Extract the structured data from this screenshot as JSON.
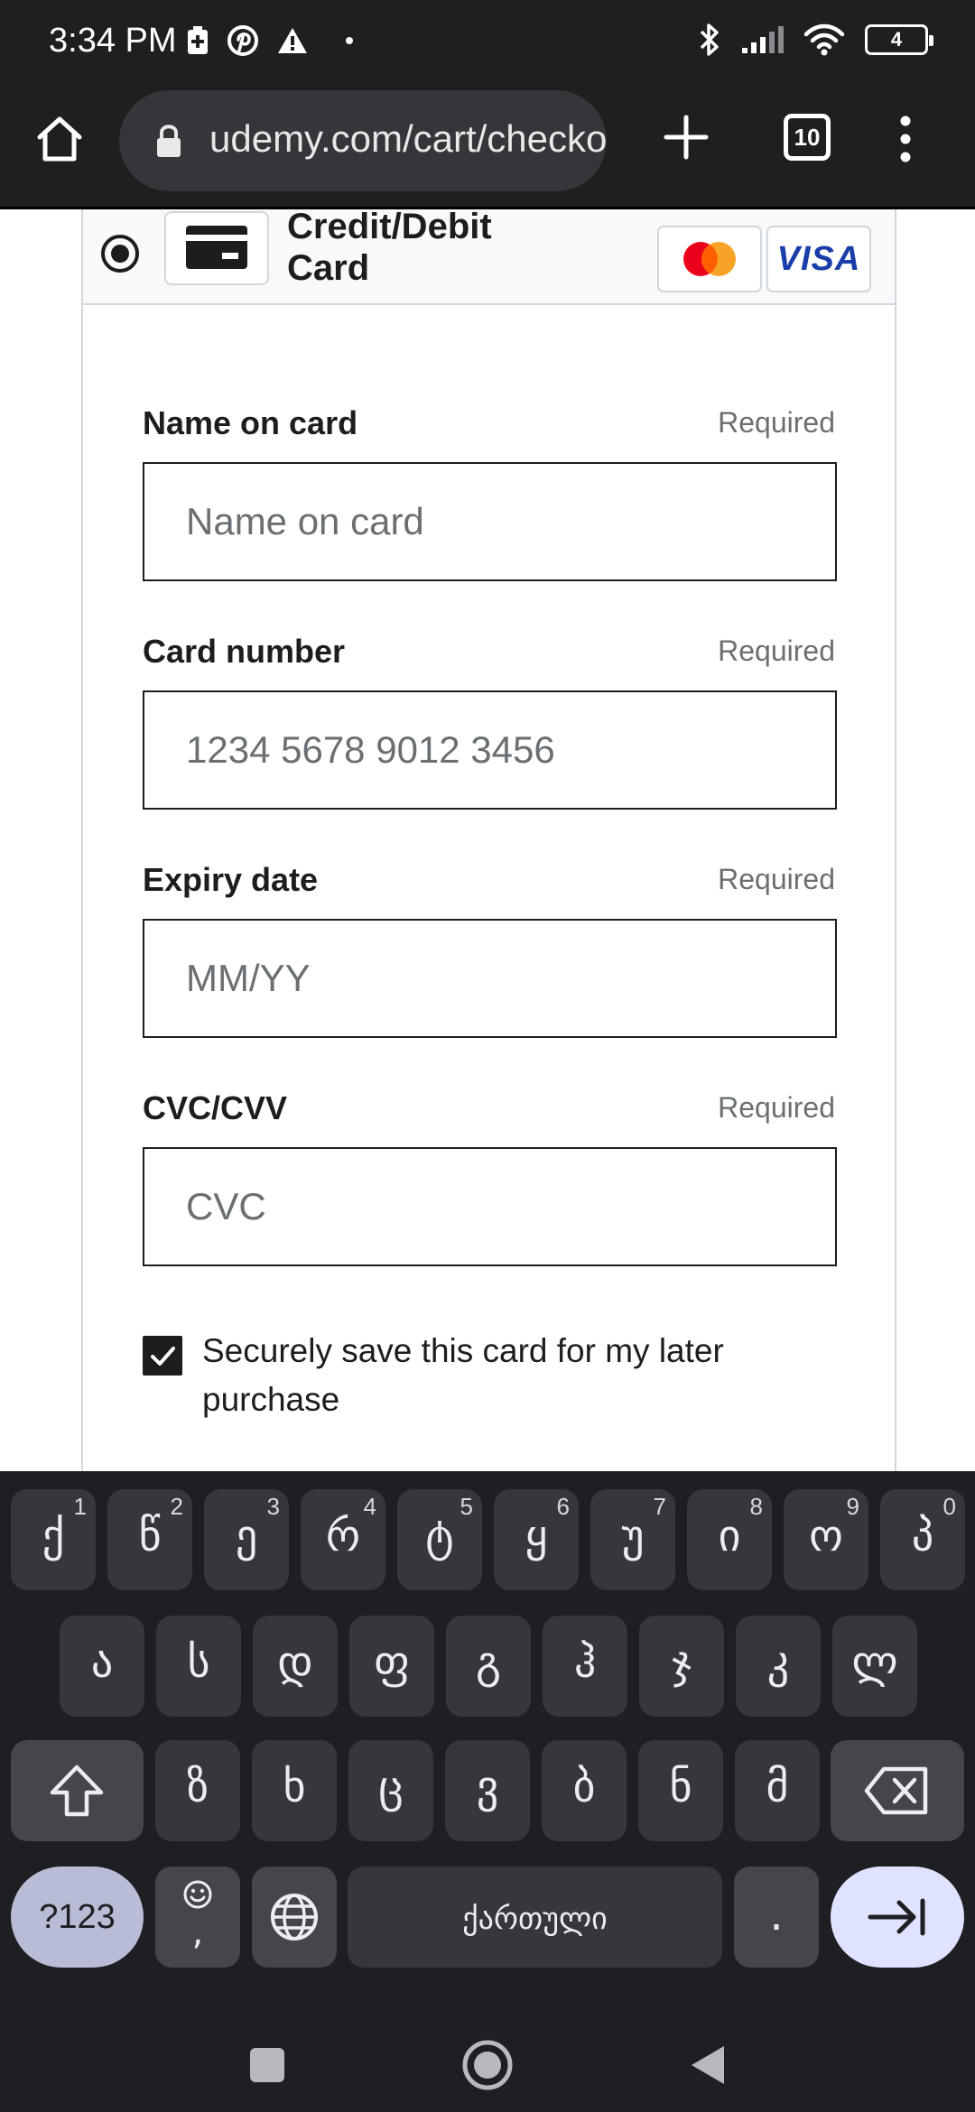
{
  "status_bar": {
    "time": "3:34 PM",
    "battery_level": "4",
    "left_icons": [
      "battery-saver-icon",
      "pinterest-icon",
      "warning-icon",
      "dot-icon"
    ],
    "right_icons": [
      "bluetooth-icon",
      "signal-icon",
      "wifi-icon",
      "battery-icon"
    ]
  },
  "browser": {
    "url": "udemy.com/cart/checkout",
    "tab_count": "10",
    "icons": [
      "home-icon",
      "lock-icon",
      "plus-icon",
      "tabs-icon",
      "more-vert-icon"
    ]
  },
  "payment": {
    "method_label_line1": "Credit/Debit",
    "method_label_line2": "Card",
    "brands": [
      "mastercard-logo",
      "visa-logo"
    ],
    "visa_text": "VISA",
    "fields": {
      "name": {
        "label": "Name on card",
        "required": "Required",
        "placeholder": "Name on card"
      },
      "number": {
        "label": "Card number",
        "required": "Required",
        "placeholder": "1234 5678 9012 3456"
      },
      "expiry": {
        "label": "Expiry date",
        "required": "Required",
        "placeholder": "MM/YY"
      },
      "cvc": {
        "label": "CVC/CVV",
        "required": "Required",
        "placeholder": "CVC"
      }
    },
    "save_card_label": "Securely save this card for my later purchase",
    "save_card_checked": true
  },
  "keyboard": {
    "row1": [
      {
        "char": "ქ",
        "hint": "1"
      },
      {
        "char": "წ",
        "hint": "2"
      },
      {
        "char": "ე",
        "hint": "3"
      },
      {
        "char": "რ",
        "hint": "4"
      },
      {
        "char": "ტ",
        "hint": "5"
      },
      {
        "char": "ყ",
        "hint": "6"
      },
      {
        "char": "უ",
        "hint": "7"
      },
      {
        "char": "ი",
        "hint": "8"
      },
      {
        "char": "ო",
        "hint": "9"
      },
      {
        "char": "პ",
        "hint": "0"
      }
    ],
    "row2": [
      "ა",
      "ს",
      "დ",
      "ფ",
      "გ",
      "ჰ",
      "ჯ",
      "კ",
      "ლ"
    ],
    "row3": [
      "ზ",
      "ხ",
      "ც",
      "ვ",
      "ბ",
      "ნ",
      "მ"
    ],
    "symbols_label": "?123",
    "emoji_comma": ",",
    "space_label": "ქართული",
    "period_label": ".",
    "icons": [
      "shift-icon",
      "backspace-icon",
      "emoji-icon",
      "globe-icon",
      "tab-next-icon"
    ]
  },
  "nav_bar": {
    "icons": [
      "recents-icon",
      "home-circle-icon",
      "back-icon"
    ]
  },
  "colors": {
    "chrome_bg": "#1f1f21",
    "url_bar_bg": "#35353a",
    "keyboard_bg": "#1e1f22",
    "key_bg": "#35373b",
    "text": "#1c1d1f",
    "muted": "#6a6f73",
    "border": "#d1d7dc"
  }
}
